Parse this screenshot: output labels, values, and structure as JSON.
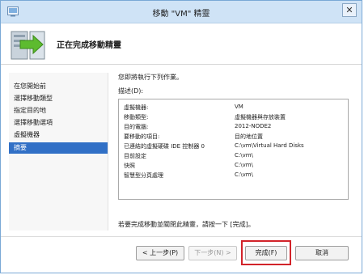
{
  "window": {
    "title": "移動 \"VM\" 精靈",
    "close_glyph": "✕"
  },
  "header": {
    "heading": "正在完成移動精靈"
  },
  "nav": {
    "items": [
      {
        "label": "在您開始前"
      },
      {
        "label": "選擇移動類型"
      },
      {
        "label": "指定目的地"
      },
      {
        "label": "選擇移動選項"
      },
      {
        "label": "虛擬機器"
      },
      {
        "label": "摘要"
      }
    ],
    "selected": "摘要"
  },
  "content": {
    "intro": "您即將執行下列作業。",
    "description_label": "描述(D):",
    "summary_rows": [
      {
        "key": "虛擬機器:",
        "value": "VM"
      },
      {
        "key": "移動類型:",
        "value": "虛擬機器與存放裝置"
      },
      {
        "key": "目的電腦:",
        "value": "2012-NODE2"
      },
      {
        "key": "要移動的項目:",
        "value": "目的地位置"
      },
      {
        "key": "已連結的虛擬硬碟 IDE 控制器 0",
        "value": "C:\\vm\\Virtual Hard Disks"
      },
      {
        "key": "目前設定",
        "value": "C:\\vm\\"
      },
      {
        "key": "快照",
        "value": "C:\\vm\\"
      },
      {
        "key": "智慧型分頁處理",
        "value": "C:\\vm\\"
      }
    ],
    "finish_note": "若要完成移動並關閉此精靈，請按一下 [完成]。"
  },
  "buttons": {
    "previous": "< 上一步(P)",
    "next": "下一步(N) >",
    "finish": "完成(F)",
    "cancel": "取消"
  },
  "colors": {
    "titlebar": "#cfe3f6",
    "nav_selected": "#3170c6",
    "highlight": "#d2232a"
  }
}
